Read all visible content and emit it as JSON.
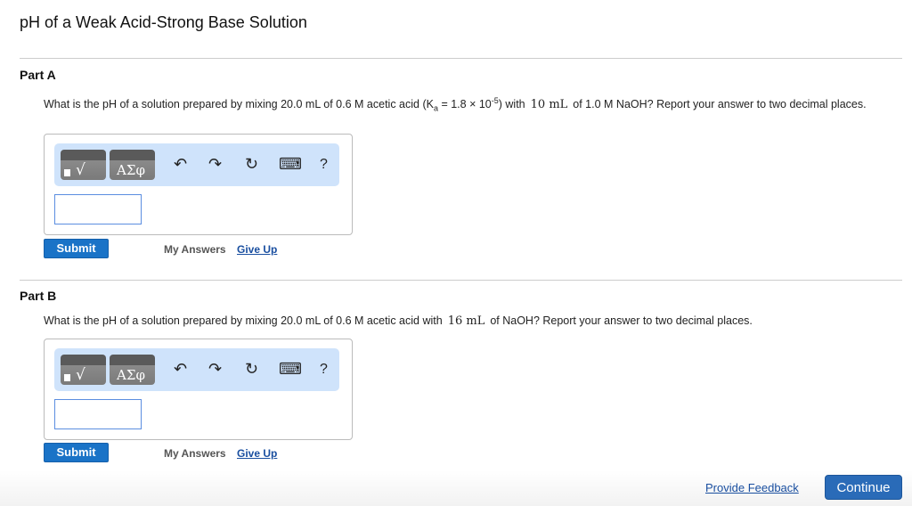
{
  "title": "pH of a Weak Acid-Strong Base Solution",
  "parts": [
    {
      "label": "Part A",
      "q1": "What is the pH of a solution prepared by mixing 20.0 mL of 0.6 M acetic acid (K",
      "sub": "a",
      "q2": " = 1.8 × 10",
      "sup": "-5",
      "q3": ") with",
      "math": "10 mL",
      "q4": "of 1.0 M NaOH? Report your answer to two decimal places.",
      "answer": "",
      "submit": "Submit",
      "my_answers": "My Answers",
      "give_up": "Give Up"
    },
    {
      "label": "Part B",
      "q1": "What is the pH of a solution prepared by mixing 20.0 mL of 0.6 M acetic acid with",
      "math": "16 mL",
      "q4": "of NaOH? Report your answer to two decimal places.",
      "answer": "",
      "submit": "Submit",
      "my_answers": "My Answers",
      "give_up": "Give Up"
    }
  ],
  "toolbar": {
    "greek": "ΑΣφ",
    "root": "√",
    "undo": "↶",
    "redo": "↷",
    "reset": "↻",
    "keyboard": "⌨",
    "help": "?"
  },
  "footer": {
    "feedback": "Provide Feedback",
    "continue": "Continue"
  }
}
